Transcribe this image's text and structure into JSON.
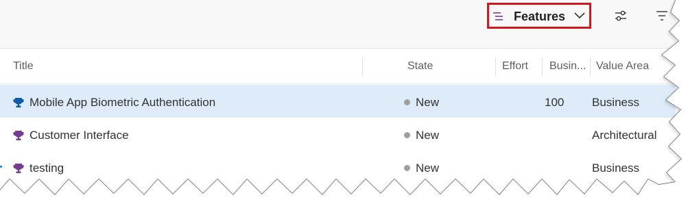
{
  "toolbar": {
    "level_label": "Features",
    "icons": {
      "level": "backlog-level-icon",
      "dropdown": "chevron-down-icon",
      "settings": "view-options-icon",
      "filter": "filter-icon"
    }
  },
  "columns": {
    "title": "Title",
    "state": "State",
    "effort": "Effort",
    "business": "Busin...",
    "value_area": "Value Area"
  },
  "rows": [
    {
      "title": "Mobile App Biometric Authentication",
      "state": "New",
      "effort": "",
      "business": "100",
      "value_area": "Business",
      "selected": true,
      "trophy_color": "#0b5cab"
    },
    {
      "title": "Customer Interface",
      "state": "New",
      "effort": "",
      "business": "",
      "value_area": "Architectural",
      "selected": false,
      "trophy_color": "#773b93"
    },
    {
      "title": "testing",
      "state": "New",
      "effort": "",
      "business": "",
      "value_area": "Business",
      "selected": false,
      "trophy_color": "#773b93"
    }
  ],
  "colors": {
    "highlight_border": "#d2161e",
    "selected_row": "#deecf9",
    "state_new": "#a19f9d",
    "level_icon": "#773b93"
  }
}
